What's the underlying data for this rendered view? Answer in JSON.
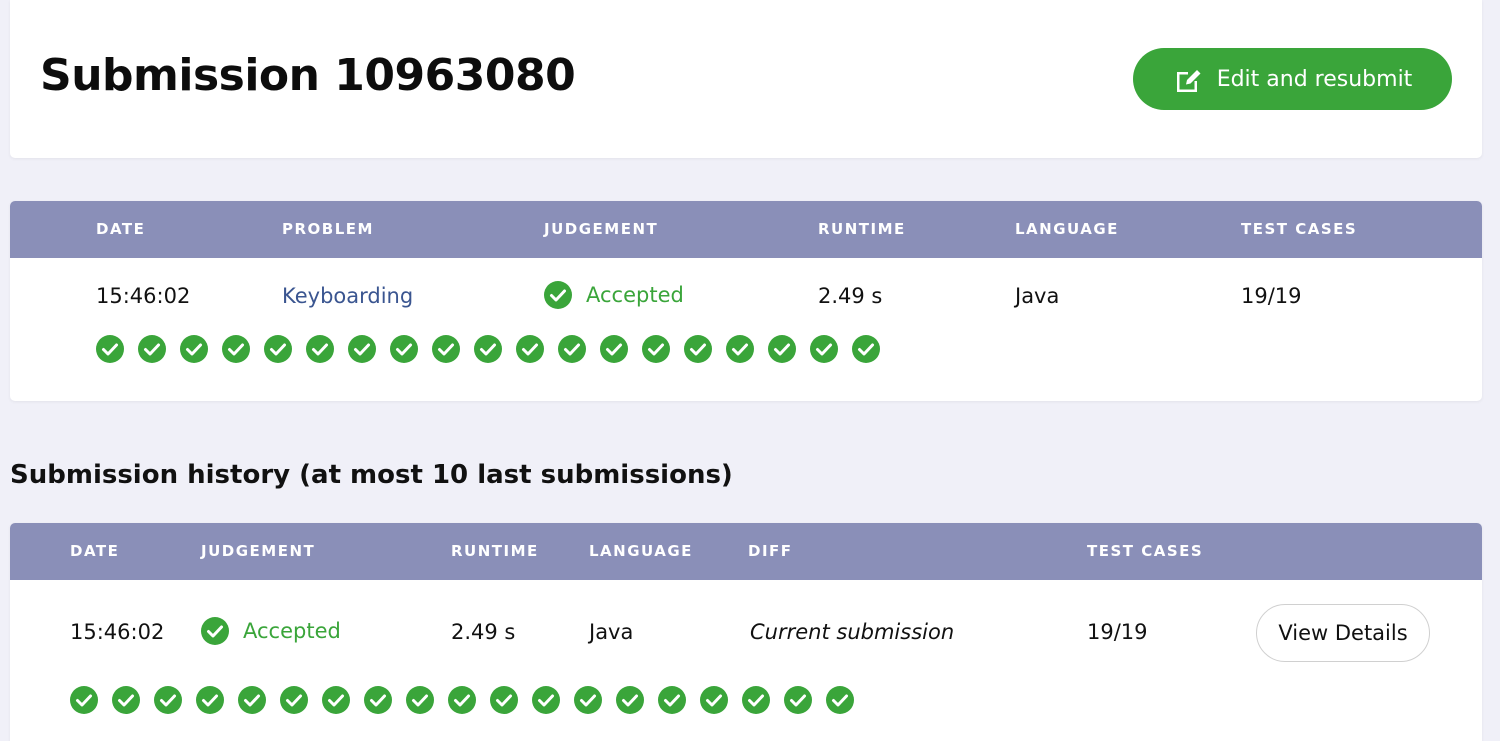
{
  "page": {
    "title": "Submission 10963080",
    "resubmit_label": "Edit and resubmit"
  },
  "submission": {
    "headers": {
      "date": "DATE",
      "problem": "PROBLEM",
      "judgement": "JUDGEMENT",
      "runtime": "RUNTIME",
      "language": "LANGUAGE",
      "test_cases": "TEST CASES"
    },
    "row": {
      "date": "15:46:02",
      "problem": "Keyboarding",
      "judgement": "Accepted",
      "runtime": "2.49 s",
      "language": "Java",
      "test_cases": "19/19",
      "passed_tests": 19
    }
  },
  "history": {
    "heading": "Submission history (at most 10 last submissions)",
    "headers": {
      "date": "DATE",
      "judgement": "JUDGEMENT",
      "runtime": "RUNTIME",
      "language": "LANGUAGE",
      "diff": "DIFF",
      "test_cases": "TEST CASES"
    },
    "rows": [
      {
        "date": "15:46:02",
        "judgement": "Accepted",
        "runtime": "2.49 s",
        "language": "Java",
        "diff": "Current submission",
        "test_cases": "19/19",
        "passed_tests": 19,
        "details_label": "View Details"
      }
    ]
  },
  "colors": {
    "accent_green": "#3aa53a",
    "table_header": "#8a8fb8",
    "link": "#3a5590"
  },
  "icons": {
    "resubmit": "edit-icon",
    "status": "check-circle-icon"
  }
}
